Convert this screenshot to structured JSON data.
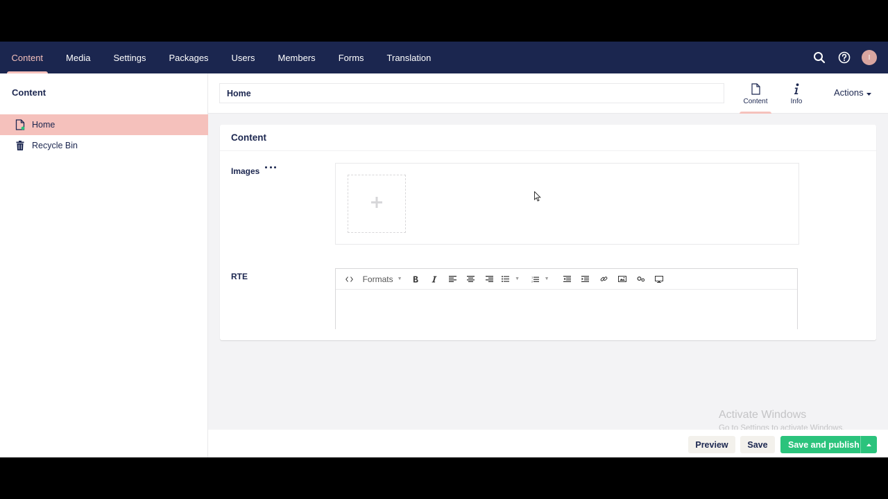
{
  "nav": {
    "sections": [
      "Content",
      "Media",
      "Settings",
      "Packages",
      "Users",
      "Members",
      "Forms",
      "Translation"
    ],
    "active_index": 0,
    "avatar_initial": "I"
  },
  "sidebar": {
    "title": "Content",
    "items": [
      {
        "label": "Home",
        "icon": "document-icon",
        "selected": true
      },
      {
        "label": "Recycle Bin",
        "icon": "trash-icon",
        "selected": false
      }
    ]
  },
  "editor": {
    "name_value": "Home",
    "tabs": [
      {
        "label": "Content",
        "icon": "document-icon",
        "active": true
      },
      {
        "label": "Info",
        "icon": "info-icon",
        "active": false
      }
    ],
    "actions_label": "Actions"
  },
  "panel": {
    "title": "Content",
    "images_label": "Images",
    "rte_label": "RTE",
    "rte_formats_label": "Formats"
  },
  "footer": {
    "preview_label": "Preview",
    "save_label": "Save",
    "publish_label": "Save and publish"
  },
  "watermark": {
    "line1": "Activate Windows",
    "line2": "Go to Settings to activate Windows."
  },
  "colors": {
    "nav_bg": "#1b264f",
    "accent": "#f5c1bc",
    "publish": "#2bc37c",
    "text": "#1b264f"
  }
}
